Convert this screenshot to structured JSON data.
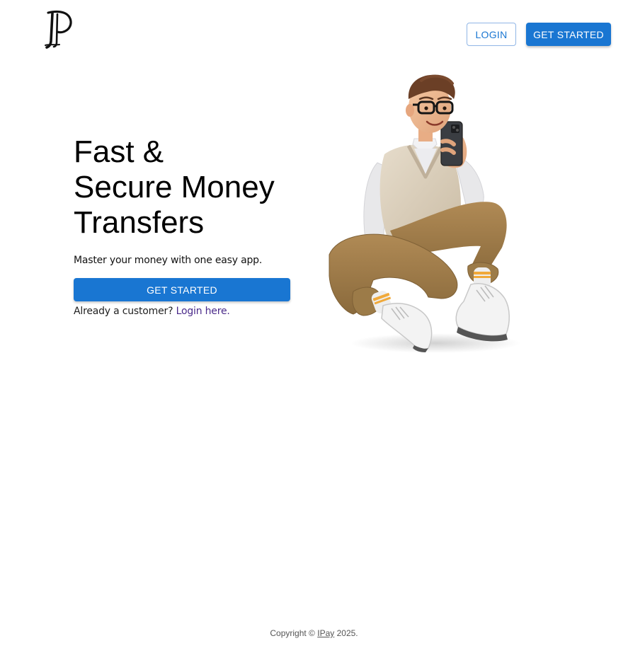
{
  "header": {
    "logo_name": "ipay-logo",
    "login_label": "LOGIN",
    "get_started_label": "GET STARTED"
  },
  "hero": {
    "title_line1": "Fast &",
    "title_line2": "Secure Money",
    "title_line3": "Transfers",
    "subtitle": "Master your money with one easy app.",
    "cta_label": "GET STARTED",
    "customer_prompt": "Already a customer?",
    "login_link": "Login here.",
    "illustration_name": "man-with-phone-illustration"
  },
  "footer": {
    "copyright_prefix": "Copyright ©",
    "brand_link": "IPay",
    "copyright_suffix": "2025."
  },
  "colors": {
    "primary": "#1976d2",
    "link": "#4a2a8a",
    "background": "#ffffff"
  }
}
